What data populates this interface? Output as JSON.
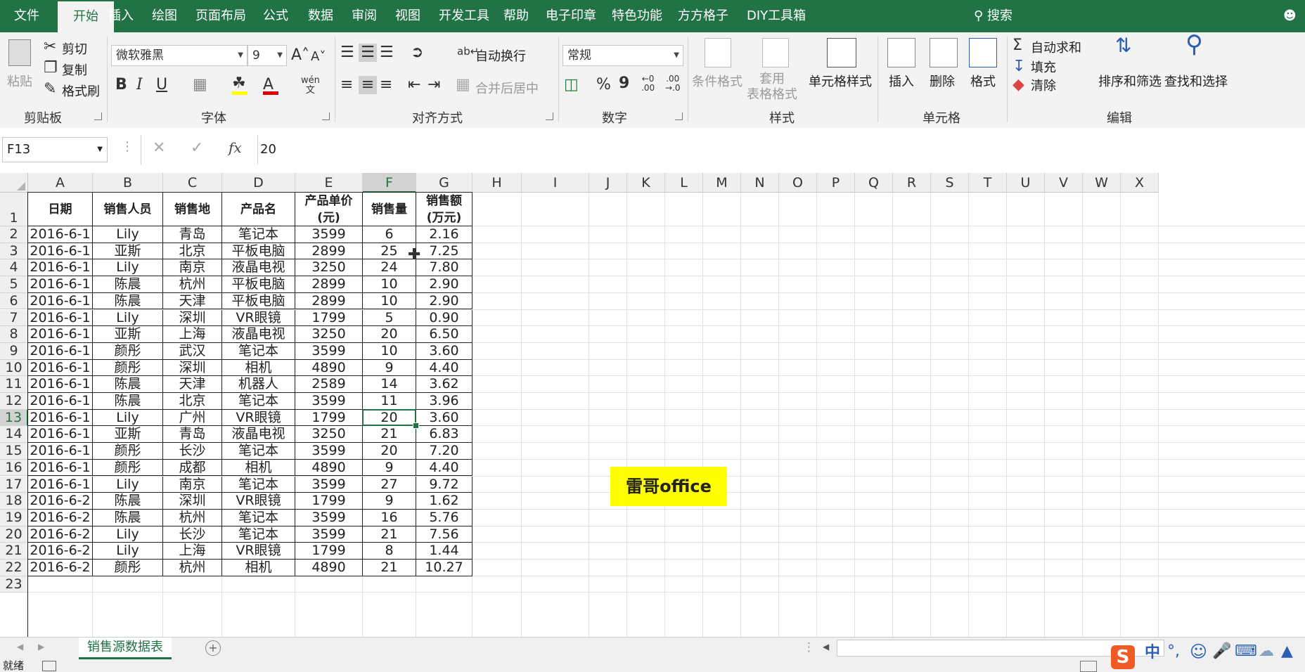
{
  "menu": {
    "items": [
      "文件",
      "开始",
      "插入",
      "绘图",
      "页面布局",
      "公式",
      "数据",
      "审阅",
      "视图",
      "开发工具",
      "帮助",
      "电子印章",
      "特色功能",
      "方方格子",
      "DIY工具箱"
    ],
    "search": "搜索"
  },
  "ribbon": {
    "clipboard": {
      "paste": "粘贴",
      "cut": "剪切",
      "copy": "复制",
      "format_painter": "格式刷",
      "label": "剪贴板"
    },
    "font": {
      "name": "微软雅黑",
      "size": "9",
      "bold": "B",
      "italic": "I",
      "underline": "U",
      "phonetic": "wén",
      "label": "字体"
    },
    "alignment": {
      "wrap": "自动换行",
      "merge": "合并后居中",
      "label": "对齐方式"
    },
    "number": {
      "format": "常规",
      "percent": "%",
      "comma": "9",
      "label": "数字"
    },
    "styles": {
      "conditional": "条件格式",
      "table_format": "套用\n表格格式",
      "cell_styles": "单元格样式",
      "label": "样式"
    },
    "cells": {
      "insert": "插入",
      "delete": "删除",
      "format": "格式",
      "label": "单元格"
    },
    "editing": {
      "autosum": "自动求和",
      "fill": "填充",
      "clear": "清除",
      "sort_filter": "排序和筛选",
      "find_select": "查找和选择",
      "label": "编辑"
    }
  },
  "formula_bar": {
    "name_box": "F13",
    "value": "20",
    "fx": "fx"
  },
  "columns": [
    "A",
    "B",
    "C",
    "D",
    "E",
    "F",
    "G",
    "H",
    "I",
    "J",
    "K",
    "L",
    "M",
    "N",
    "O",
    "P",
    "Q",
    "R",
    "S",
    "T",
    "U",
    "V",
    "W",
    "X"
  ],
  "table": {
    "headers": [
      "日期",
      "销售人员",
      "销售地",
      "产品名",
      "产品单价\n(元)",
      "销售量",
      "销售额\n(万元)"
    ],
    "rows": [
      [
        "2016-6-1",
        "Lily",
        "青岛",
        "笔记本",
        "3599",
        "6",
        "2.16"
      ],
      [
        "2016-6-1",
        "亚斯",
        "北京",
        "平板电脑",
        "2899",
        "25",
        "7.25"
      ],
      [
        "2016-6-1",
        "Lily",
        "南京",
        "液晶电视",
        "3250",
        "24",
        "7.80"
      ],
      [
        "2016-6-1",
        "陈晨",
        "杭州",
        "平板电脑",
        "2899",
        "10",
        "2.90"
      ],
      [
        "2016-6-1",
        "陈晨",
        "天津",
        "平板电脑",
        "2899",
        "10",
        "2.90"
      ],
      [
        "2016-6-1",
        "Lily",
        "深圳",
        "VR眼镜",
        "1799",
        "5",
        "0.90"
      ],
      [
        "2016-6-1",
        "亚斯",
        "上海",
        "液晶电视",
        "3250",
        "20",
        "6.50"
      ],
      [
        "2016-6-1",
        "颜彤",
        "武汉",
        "笔记本",
        "3599",
        "10",
        "3.60"
      ],
      [
        "2016-6-1",
        "颜彤",
        "深圳",
        "相机",
        "4890",
        "9",
        "4.40"
      ],
      [
        "2016-6-1",
        "陈晨",
        "天津",
        "机器人",
        "2589",
        "14",
        "3.62"
      ],
      [
        "2016-6-1",
        "陈晨",
        "北京",
        "笔记本",
        "3599",
        "11",
        "3.96"
      ],
      [
        "2016-6-1",
        "Lily",
        "广州",
        "VR眼镜",
        "1799",
        "20",
        "3.60"
      ],
      [
        "2016-6-1",
        "亚斯",
        "青岛",
        "液晶电视",
        "3250",
        "21",
        "6.83"
      ],
      [
        "2016-6-1",
        "颜彤",
        "长沙",
        "笔记本",
        "3599",
        "20",
        "7.20"
      ],
      [
        "2016-6-1",
        "颜彤",
        "成都",
        "相机",
        "4890",
        "9",
        "4.40"
      ],
      [
        "2016-6-1",
        "Lily",
        "南京",
        "笔记本",
        "3599",
        "27",
        "9.72"
      ],
      [
        "2016-6-2",
        "陈晨",
        "深圳",
        "VR眼镜",
        "1799",
        "9",
        "1.62"
      ],
      [
        "2016-6-2",
        "陈晨",
        "杭州",
        "笔记本",
        "3599",
        "16",
        "5.76"
      ],
      [
        "2016-6-2",
        "Lily",
        "长沙",
        "笔记本",
        "3599",
        "21",
        "7.56"
      ],
      [
        "2016-6-2",
        "Lily",
        "上海",
        "VR眼镜",
        "1799",
        "8",
        "1.44"
      ],
      [
        "2016-6-2",
        "颜彤",
        "杭州",
        "相机",
        "4890",
        "21",
        "10.27"
      ]
    ]
  },
  "watermark": "雷哥office",
  "sheet_tab": "销售源数据表",
  "status": {
    "ready": "就绪",
    "ime": "中"
  },
  "colors": {
    "accent": "#217346",
    "watermark_bg": "#ffff00"
  }
}
